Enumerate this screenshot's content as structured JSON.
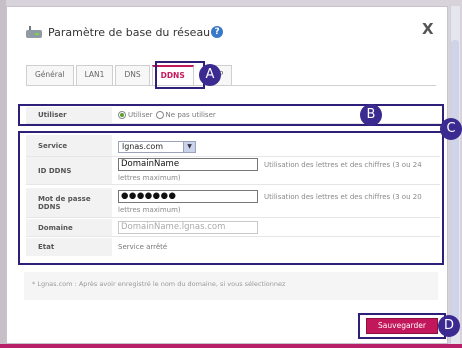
{
  "dialog": {
    "title": "Paramètre de base du réseau",
    "help_icon": "?",
    "close_label": "X"
  },
  "tabs": [
    {
      "label": "Général"
    },
    {
      "label": "LAN1"
    },
    {
      "label": "DNS"
    },
    {
      "label": "DDNS"
    },
    {
      "label": "P"
    }
  ],
  "callouts": {
    "a": "A",
    "b": "B",
    "c": "C",
    "d": "D"
  },
  "utiliser": {
    "label": "Utiliser",
    "option_on": "Utiliser",
    "option_off": "Ne pas utiliser"
  },
  "service": {
    "label": "Service",
    "value": "lgnas.com"
  },
  "id_ddns": {
    "label": "ID DDNS",
    "value": "DomainName",
    "note_line1": "Utilisation des lettres et des chiffres (3 ou 24",
    "note_line2": "lettres maximum)"
  },
  "password": {
    "label_line1": "Mot de passe",
    "label_line2": "DDNS",
    "value": "●●●●●●●",
    "note_line1": "Utilisation des lettres et des chiffres (3 ou 20",
    "note_line2": "lettres maximum)"
  },
  "domaine": {
    "label": "Domaine",
    "placeholder": "DomainName.lgnas.com"
  },
  "etat": {
    "label": "Etat",
    "value": "Service arrêté"
  },
  "footer": {
    "note": "* Lgnas.com : Après avoir enregistré le nom du domaine, si vous sélectionnez"
  },
  "save_button": "Sauvegarder",
  "colors": {
    "accent": "#c2185b",
    "callout": "#3b2a90"
  }
}
